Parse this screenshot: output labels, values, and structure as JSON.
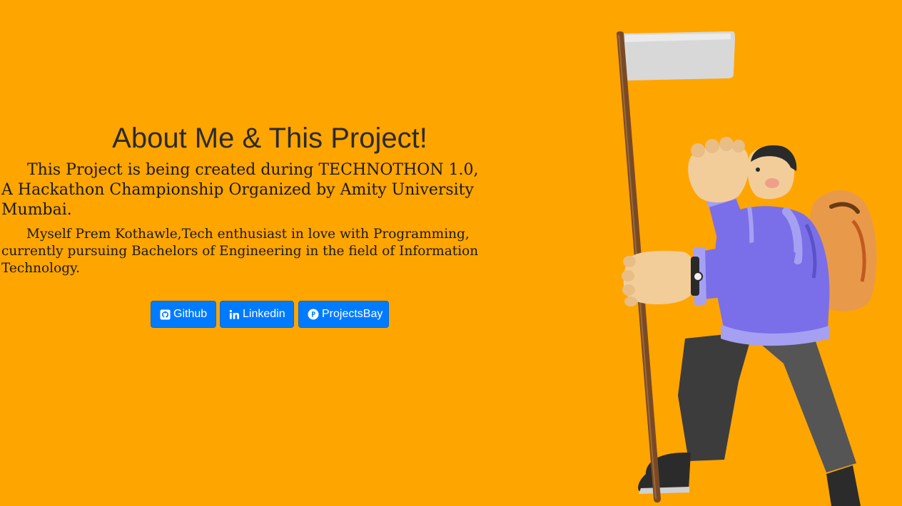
{
  "about": {
    "title": "About Me & This Project!",
    "paragraph1": "This Project is being created during TECHNOTHON 1.0, A Hackathon Championship Organized by Amity University Mumbai.",
    "paragraph2": "Myself Prem Kothawle,Tech enthusiast in love with Programming, currently pursuing Bachelors of Engineering in the field of Information Technology."
  },
  "buttons": [
    {
      "label": "Github",
      "icon": "github-icon"
    },
    {
      "label": "Linkedin",
      "icon": "linkedin-icon"
    },
    {
      "label": "ProjectsBay",
      "icon": "projectsbay-icon"
    }
  ],
  "colors": {
    "background": "#FFA500",
    "button": "#007bff",
    "title_text": "#2b2b2b"
  },
  "illustration": {
    "subject": "3d-character-hiker-with-white-flag-and-backpack"
  }
}
